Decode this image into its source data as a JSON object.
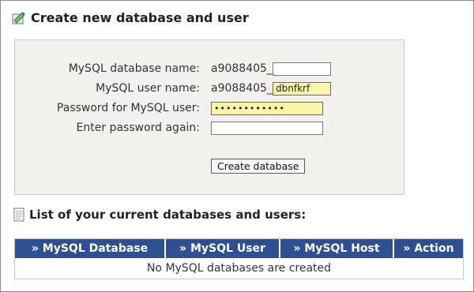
{
  "create_section": {
    "title": "Create new database and user",
    "icon": "database-edit-icon",
    "fields": {
      "db_name_label": "MySQL database name:",
      "db_prefix": "a9088405_",
      "db_name_value": "",
      "user_name_label": "MySQL user name:",
      "user_prefix": "a9088405_",
      "user_name_value": "dbnfkrf",
      "password_label": "Password for MySQL user:",
      "password_value": "••••••••••••",
      "password_again_label": "Enter password again:",
      "password_again_value": ""
    },
    "submit_label": "Create database"
  },
  "list_section": {
    "title": "List of your current databases and users:",
    "icon": "document-list-icon",
    "columns": [
      "» MySQL Database",
      "» MySQL User",
      "» MySQL Host",
      "» Action"
    ],
    "empty_message": "No MySQL databases are created"
  },
  "colors": {
    "header_bg": "#2e4f92",
    "panel_bg": "#f2f1ee",
    "autofill_yellow": "#fcf4a9"
  }
}
